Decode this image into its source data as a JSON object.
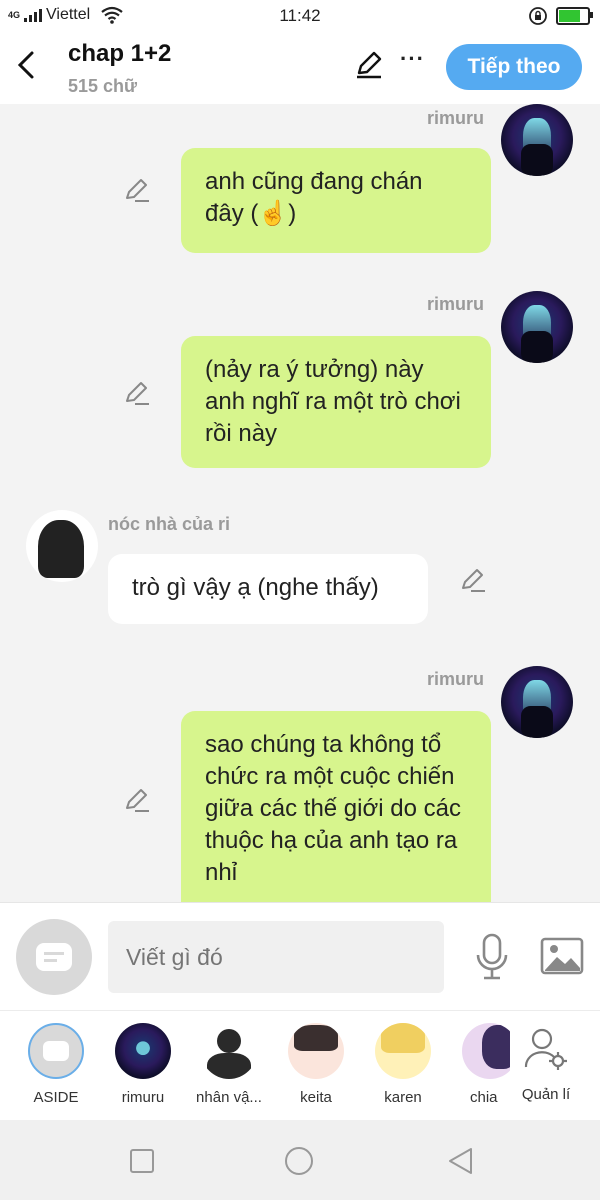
{
  "status_bar": {
    "network": "4G",
    "carrier": "Viettel",
    "time": "11:42"
  },
  "header": {
    "title": "chap 1+2",
    "word_count": "515 chữ",
    "next_label": "Tiếp theo",
    "more_label": "···"
  },
  "messages": [
    {
      "sender": "rimuru",
      "text": "anh cũng đang chán đây (☝️)",
      "side": "right"
    },
    {
      "sender": "rimuru",
      "text": "(nảy ra ý tưởng) này anh nghĩ ra một trò chơi rồi này",
      "side": "right"
    },
    {
      "sender": "nóc nhà của ri",
      "text": "trò gì vậy ạ (nghe thấy)",
      "side": "left"
    },
    {
      "sender": "rimuru",
      "text": "sao chúng ta không tổ chức ra một cuộc chiến giữa các thế giới do các thuộc hạ của anh tạo ra nhỉ",
      "side": "right"
    }
  ],
  "composer": {
    "placeholder": "Viết gì đó"
  },
  "characters": [
    {
      "label": "ASIDE"
    },
    {
      "label": "rimuru"
    },
    {
      "label": "nhân vậ..."
    },
    {
      "label": "keita"
    },
    {
      "label": "karen"
    },
    {
      "label": "chia"
    },
    {
      "label": "Quản lí"
    }
  ],
  "colors": {
    "accent": "#55aaf1",
    "bubble_green": "#d7f58d",
    "background": "#f3f3f3"
  }
}
